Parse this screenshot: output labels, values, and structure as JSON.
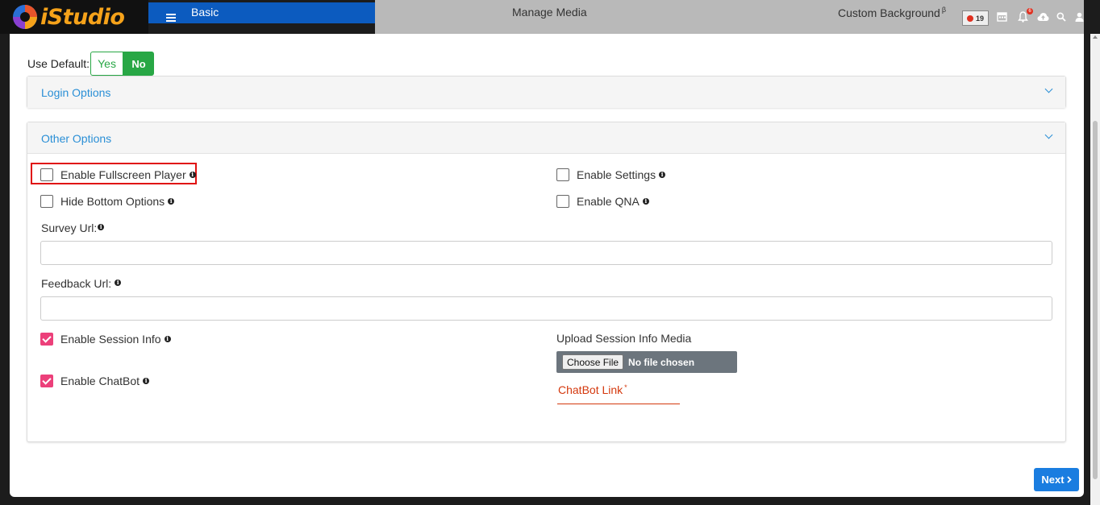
{
  "app": {
    "logo_text": "iStudio"
  },
  "tabs": {
    "basic": "Basic",
    "manage_media": "Manage Media",
    "custom_background": "Custom Background",
    "custom_background_sup": "β"
  },
  "header": {
    "live_count": "19",
    "notification_count": "6"
  },
  "use_default": {
    "label": "Use Default:",
    "yes": "Yes",
    "no": "No",
    "selected": "No"
  },
  "panels": {
    "login_options": "Login Options",
    "other_options": "Other Options"
  },
  "options": {
    "enable_fullscreen_player": "Enable Fullscreen Player",
    "enable_settings": "Enable Settings",
    "hide_bottom_options": "Hide Bottom Options",
    "enable_qna": "Enable QNA",
    "survey_url_label": "Survey Url:",
    "survey_url_value": "",
    "feedback_url_label": "Feedback Url:",
    "feedback_url_value": "",
    "enable_session_info": "Enable Session Info",
    "enable_chatbot": "Enable ChatBot",
    "upload_session_info_media": "Upload Session Info Media",
    "choose_file": "Choose File",
    "no_file_chosen": "No file chosen",
    "chatbot_link_label": "ChatBot Link",
    "chatbot_link_required": "*"
  },
  "checkbox_states": {
    "enable_fullscreen_player": false,
    "enable_settings": false,
    "hide_bottom_options": false,
    "enable_qna": false,
    "enable_session_info": true,
    "enable_chatbot": true
  },
  "footer": {
    "next": "Next"
  },
  "colors": {
    "primary": "#0c5bbf",
    "success": "#28a745",
    "checkbox_checked": "#ec407a",
    "link": "#2a8fd6",
    "required": "#d4380d"
  }
}
